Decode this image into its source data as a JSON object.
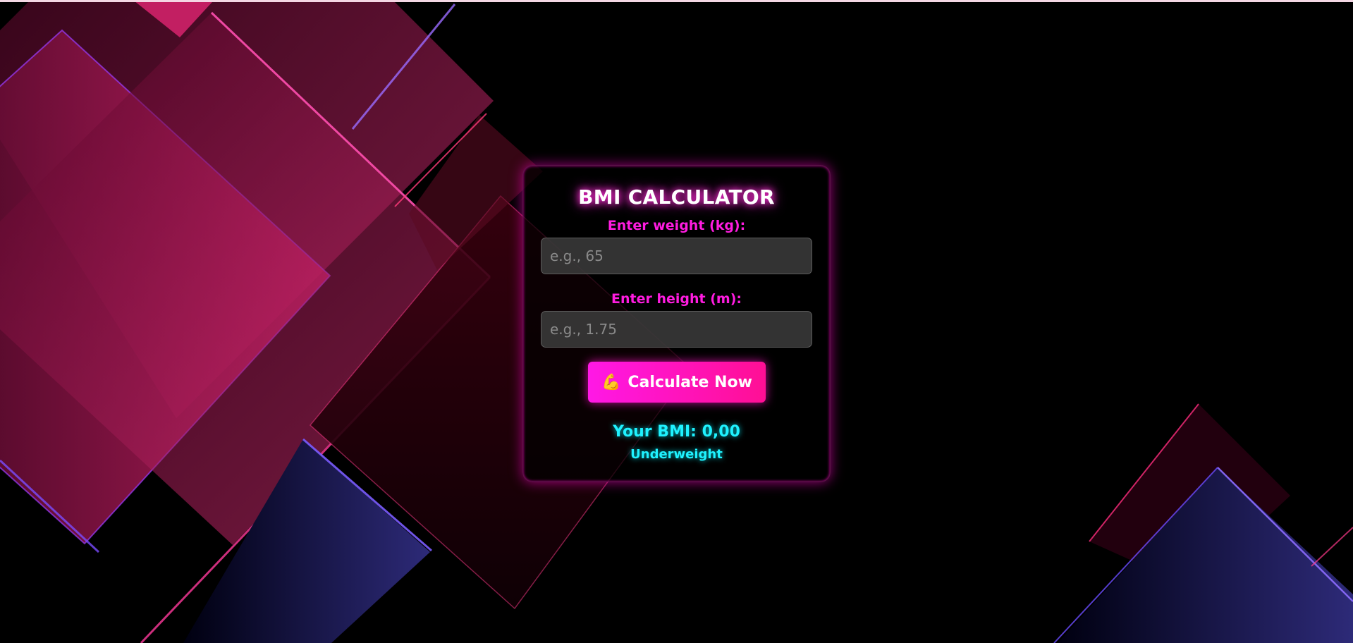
{
  "app": {
    "title": "BMI CALCULATOR",
    "weight_label": "Enter weight (kg):",
    "weight_placeholder": "e.g., 65",
    "weight_value": "",
    "height_label": "Enter height (m):",
    "height_placeholder": "e.g., 1.75",
    "height_value": "",
    "button_icon": "💪",
    "button_label": "Calculate Now",
    "result_text": "Your BMI: 0,00",
    "category_text": "Underweight"
  },
  "icons": {
    "button_icon_name": "flexed-biceps-icon"
  },
  "colors": {
    "accent": "#ff1ce0",
    "button_start": "#ff18e6",
    "button_end": "#ff0f94",
    "result": "#1ff2ff",
    "background": "#000000"
  }
}
